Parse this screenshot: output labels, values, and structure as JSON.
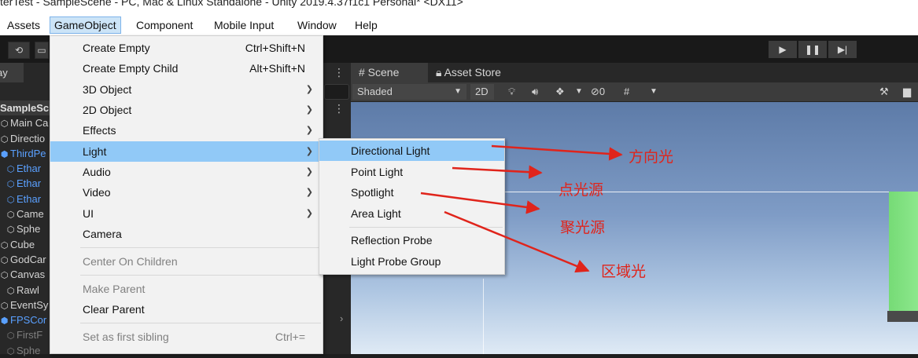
{
  "title_bar": {
    "text": "terTest - SampleScene - PC, Mac & Linux Standalone - Unity 2019.4.37f1c1 Personal* <DX11>"
  },
  "menubar": {
    "items": [
      {
        "label": "Assets"
      },
      {
        "label": "GameObject"
      },
      {
        "label": "Component"
      },
      {
        "label": "Mobile Input"
      },
      {
        "label": "Window"
      },
      {
        "label": "Help"
      }
    ]
  },
  "toolbar": {
    "left_icons": [
      "refresh-icon",
      "rect-tool-icon"
    ],
    "play_controls": [
      "▶",
      "❚❚",
      "▶|"
    ]
  },
  "hierarchy": {
    "tab_label": "ay",
    "items": [
      {
        "label": "SampleSc",
        "type": "scene"
      },
      {
        "label": "Main Ca",
        "type": "normal"
      },
      {
        "label": "Directio",
        "type": "normal"
      },
      {
        "label": "ThirdPe",
        "type": "blue"
      },
      {
        "label": "Ethar",
        "type": "blue"
      },
      {
        "label": "Ethar",
        "type": "blue"
      },
      {
        "label": "Ethar",
        "type": "blue"
      },
      {
        "label": "Came",
        "type": "normal"
      },
      {
        "label": "Sphe",
        "type": "normal"
      },
      {
        "label": "Cube",
        "type": "normal"
      },
      {
        "label": "GodCar",
        "type": "normal"
      },
      {
        "label": "Canvas",
        "type": "normal"
      },
      {
        "label": "Rawl",
        "type": "normal"
      },
      {
        "label": "EventSy",
        "type": "normal"
      },
      {
        "label": "FPSCor",
        "type": "blue"
      },
      {
        "label": "FirstF",
        "type": "dim"
      },
      {
        "label": "Sphe",
        "type": "dim"
      }
    ]
  },
  "scene_view": {
    "tabs": [
      {
        "label": "# Scene",
        "active": true
      },
      {
        "label": "Asset Store",
        "active": false
      }
    ],
    "shading_mode": "Shaded",
    "mode_2d": "2D",
    "hidden_count": "0"
  },
  "gameobject_menu": {
    "items": [
      {
        "label": "Create Empty",
        "shortcut": "Ctrl+Shift+N"
      },
      {
        "label": "Create Empty Child",
        "shortcut": "Alt+Shift+N"
      },
      {
        "label": "3D Object",
        "submenu": true
      },
      {
        "label": "2D Object",
        "submenu": true
      },
      {
        "label": "Effects",
        "submenu": true
      },
      {
        "label": "Light",
        "submenu": true,
        "highlighted": true
      },
      {
        "label": "Audio",
        "submenu": true
      },
      {
        "label": "Video",
        "submenu": true
      },
      {
        "label": "UI",
        "submenu": true
      },
      {
        "label": "Camera"
      },
      {
        "label": "Center On Children",
        "disabled": true
      },
      {
        "label": "Make Parent",
        "disabled": true
      },
      {
        "label": "Clear Parent"
      },
      {
        "label": "Set as first sibling",
        "shortcut": "Ctrl+=",
        "disabled": true
      }
    ]
  },
  "light_submenu": {
    "items": [
      {
        "label": "Directional Light",
        "highlighted": true
      },
      {
        "label": "Point Light"
      },
      {
        "label": "Spotlight"
      },
      {
        "label": "Area Light"
      },
      {
        "label": "Reflection Probe"
      },
      {
        "label": "Light Probe Group"
      }
    ]
  },
  "annotations": {
    "directional": "方向光",
    "point": "点光源",
    "spot": "聚光源",
    "area": "区域光",
    "color": "#e0241b"
  }
}
